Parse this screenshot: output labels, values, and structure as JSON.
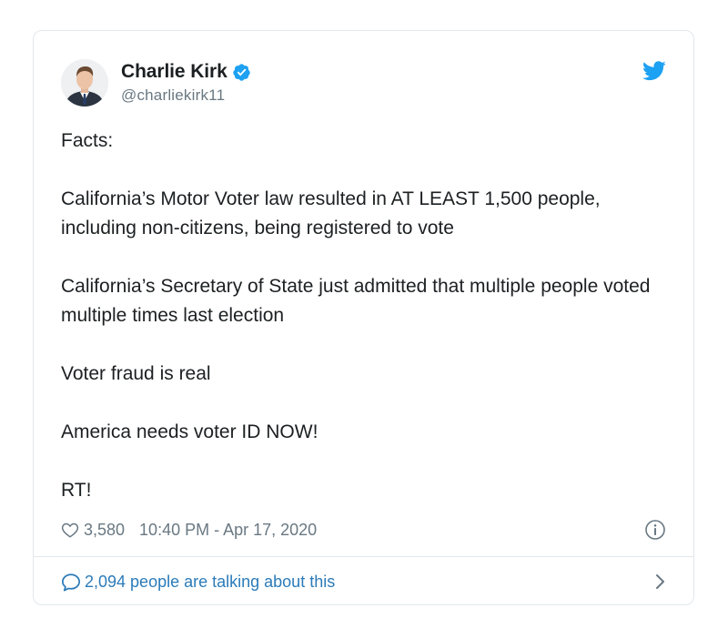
{
  "author": {
    "display_name": "Charlie Kirk",
    "handle": "@charliekirk11",
    "verified": true
  },
  "icons": {
    "avatar": "avatar-photo",
    "verified": "verified-badge-icon",
    "brand": "twitter-bird-icon",
    "like": "heart-icon",
    "info": "info-icon",
    "reply": "speech-bubble-icon",
    "more": "chevron-right-icon"
  },
  "tweet": {
    "paragraphs": [
      "Facts:",
      "California’s Motor Voter law resulted in AT LEAST 1,500 people, including non-citizens, being registered to vote",
      "California’s Secretary of State just admitted that multiple people voted multiple times last election",
      "Voter fraud is real",
      "America needs voter ID NOW!",
      "RT!"
    ]
  },
  "meta": {
    "likes": "3,580",
    "timestamp": "10:40 PM - Apr 17, 2020"
  },
  "footer": {
    "conversation_label": "2,094 people are talking about this"
  },
  "colors": {
    "brand_blue": "#1da1f2",
    "link_blue": "#2b7bb9",
    "text": "#1c2022",
    "muted": "#697882",
    "border": "#e1e8ed"
  }
}
